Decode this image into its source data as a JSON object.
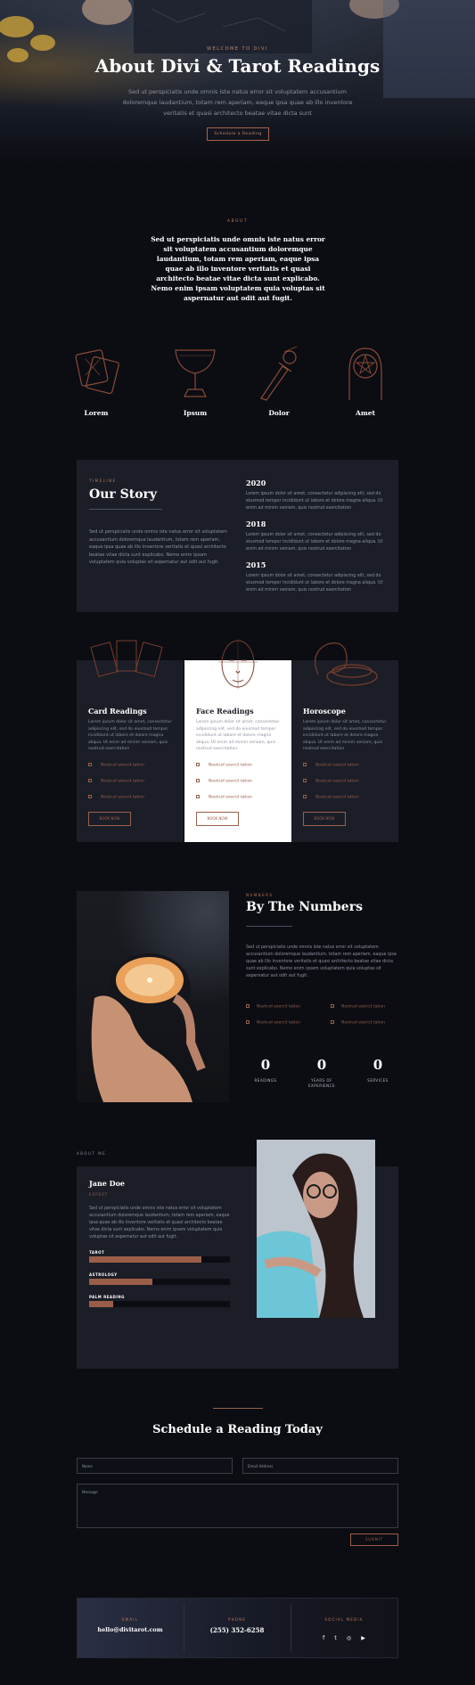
{
  "hero": {
    "kicker": "WELCOME TO DIVI",
    "title": "About Divi & Tarot Readings",
    "text": "Sed ut perspiciatis unde omnis iste natus error sit voluptatem accusantium doloremque laudantium, totam rem aperiam, eaque ipsa quae ab illo inventore veritatis et quasi architecto beatae vitae dicta sunt",
    "button": "Schedule a Reading"
  },
  "about": {
    "kicker": "ABOUT",
    "text": "Sed ut perspiciatis unde omnis iste natus error sit voluptatem accusantium doloremque laudantium, totam rem aperiam, eaque ipsa quae ab illo inventore veritatis et quasi architecto beatae vitae dicta sunt explicabo. Nemo enim ipsam voluptatem quia voluptas sit aspernatur aut odit aut fugit.",
    "icons": [
      {
        "label": "Lorem",
        "icon": "tarot-cards-icon"
      },
      {
        "label": "Ipsum",
        "icon": "chalice-icon"
      },
      {
        "label": "Dolor",
        "icon": "dagger-icon"
      },
      {
        "label": "Amet",
        "icon": "pentacle-hand-icon"
      }
    ]
  },
  "story": {
    "kicker": "TIMELINE",
    "title": "Our Story",
    "text": "Sed ut perspiciatis unde omnis iste natus error sit voluptatem accusantium doloremque laudantium, totam rem aperiam, eaque ipsa quae ab illo inventore veritatis et quasi architecto beatae vitae dicta sunt explicabo. Nemo enim ipsam voluptatem quia voluptas sit aspernatur aut odit aut fugit.",
    "timeline": [
      {
        "year": "2020",
        "text": "Lorem ipsum dolor sit amet, consectetur adipiscing elit, sed do eiusmod tempor incididunt ut labore et dolore magna aliqua. Ut enim ad minim veniam, quis nostrud exercitation"
      },
      {
        "year": "2018",
        "text": "Lorem ipsum dolor sit amet, consectetur adipiscing elit, sed do eiusmod tempor incididunt ut labore et dolore magna aliqua. Ut enim ad minim veniam, quis nostrud exercitation"
      },
      {
        "year": "2015",
        "text": "Lorem ipsum dolor sit amet, consectetur adipiscing elit, sed do eiusmod tempor incididunt ut labore et dolore magna aliqua. Ut enim ad minim veniam, quis nostrud exercitation"
      }
    ]
  },
  "services": [
    {
      "title": "Card Readings",
      "text": "Lorem ipsum dolor sit amet, consectetur adipiscing elit, sed do eiusmod tempor incididunt ut labore et dolore magna aliqua. Ut enim ad minim veniam, quis nostrud exercitation",
      "features": [
        "Nostrud exercit tation",
        "Nostrud exercit tation",
        "Nostrud exercit tation"
      ],
      "button": "BOOK NOW"
    },
    {
      "title": "Face Readings",
      "text": "Lorem ipsum dolor sit amet, consectetur adipiscing elit, sed do eiusmod tempor incididunt ut labore et dolore magna aliqua. Ut enim ad minim veniam, quis nostrud exercitation",
      "features": [
        "Nostrud exercit tation",
        "Nostrud exercit tation",
        "Nostrud exercit tation"
      ],
      "button": "BOOK NOW"
    },
    {
      "title": "Horoscope",
      "text": "Lorem ipsum dolor sit amet, consectetur adipiscing elit, sed do eiusmod tempor incididunt ut labore et dolore magna aliqua. Ut enim ad minim veniam, quis nostrud exercitation",
      "features": [
        "Nostrud exercit tation",
        "Nostrud exercit tation",
        "Nostrud exercit tation"
      ],
      "button": "BOOK NOW"
    }
  ],
  "numbers": {
    "kicker": "NUMBERS",
    "title": "By The Numbers",
    "text": "Sed ut perspiciatis unde omnis iste natus error sit voluptatem accusantium doloremque laudantium, totam rem aperiam, eaque ipsa quae ab illo inventore veritatis et quasi architecto beatae vitae dicta sunt explicabo. Nemo enim ipsam voluptatem quia voluptas sit aspernatur aut odit aut fugit.",
    "features": [
      "Nostrud exercit tation",
      "Nostrud exercit tation",
      "Nostrud exercit tation",
      "Nostrud exercit tation"
    ],
    "counters": [
      {
        "value": "0",
        "label": "READINGS"
      },
      {
        "value": "0",
        "label": "YEARS OF EXPERIENCE"
      },
      {
        "value": "0",
        "label": "SERVICES"
      }
    ]
  },
  "me": {
    "kicker": "ABOUT ME",
    "name": "Jane Doe",
    "role": "EXPERT",
    "text": "Sed ut perspiciatis unde omnis iste natus error sit voluptatem accusantium doloremque laudantium, totam rem aperiam, eaque ipsa quae ab illo inventore veritatis et quasi architecto beatae vitae dicta sunt explicabo. Nemo enim ipsam voluptatem quia voluptas sit aspernatur aut odit aut fugit.",
    "skills": [
      {
        "label": "TAROT",
        "level": 0.8
      },
      {
        "label": "ASTROLOGY",
        "level": 0.45
      },
      {
        "label": "PALM READING",
        "level": 0.17
      }
    ]
  },
  "contact": {
    "title": "Schedule a Reading Today",
    "name_placeholder": "Name",
    "email_placeholder": "Email Address",
    "message_placeholder": "Message",
    "submit": "SUBMIT"
  },
  "footer": {
    "email_label": "EMAIL",
    "email": "hello@divitarot.com",
    "phone_label": "PHONE",
    "phone": "(255) 352-6258",
    "social_label": "SOCIAL MEDIA",
    "social": [
      "f",
      "t",
      "◎",
      "▶"
    ]
  },
  "colors": {
    "accent": "#9a5e48",
    "background": "#0b0d13",
    "card": "#1b1e27"
  }
}
